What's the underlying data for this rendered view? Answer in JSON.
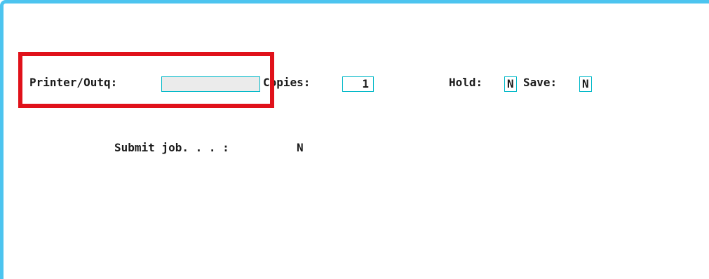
{
  "form": {
    "printer_label": "Printer/Outq:",
    "printer_value": "",
    "copies_label": "Copies:",
    "copies_value": "1",
    "hold_label": "Hold:",
    "hold_value": "N",
    "save_label": "Save:",
    "save_value": "N",
    "submit_label": "Submit job. . . :",
    "submit_value": "N"
  },
  "colors": {
    "frame_border": "#4cc4ef",
    "field_border": "#00b8c8",
    "highlight": "#e0111a",
    "printer_field_bg": "#ebebeb"
  }
}
